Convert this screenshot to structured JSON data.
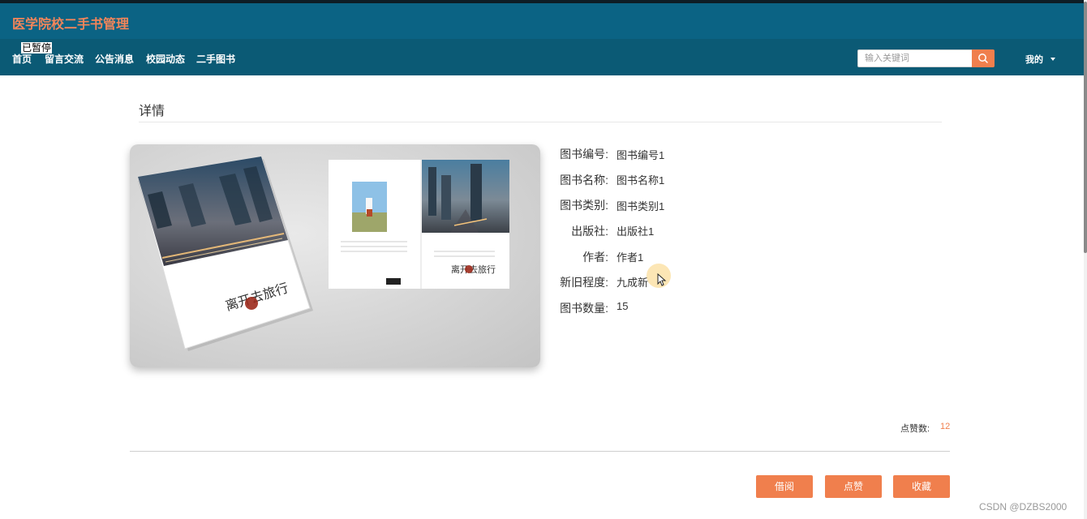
{
  "header": {
    "title": "医学院校二手书管理"
  },
  "nav": {
    "items": [
      "首页",
      "留言交流",
      "公告消息",
      "校园动态",
      "二手图书"
    ]
  },
  "overlay": {
    "paused": "已暂停"
  },
  "search": {
    "placeholder": "输入关键词",
    "icon": "search-icon"
  },
  "user_menu": {
    "label": "我的"
  },
  "section": {
    "title": "详情"
  },
  "book_image": {
    "cover_title": "离开去旅行",
    "back_title": "离开去旅行"
  },
  "details": [
    {
      "label": "图书编号:",
      "value": "图书编号1"
    },
    {
      "label": "图书名称:",
      "value": "图书名称1"
    },
    {
      "label": "图书类别:",
      "value": "图书类别1"
    },
    {
      "label": "出版社:",
      "value": "出版社1"
    },
    {
      "label": "作者:",
      "value": "作者1"
    },
    {
      "label": "新旧程度:",
      "value": "九成新"
    },
    {
      "label": "图书数量:",
      "value": "15"
    }
  ],
  "likes": {
    "label": "点赞数:",
    "value": "12"
  },
  "actions": {
    "borrow": "借阅",
    "like": "点赞",
    "favorite": "收藏"
  },
  "watermark": "CSDN @DZBS2000",
  "colors": {
    "header": "#0b6384",
    "nav": "#0b5a75",
    "accent": "#f07f4d",
    "title": "#f2855a"
  }
}
